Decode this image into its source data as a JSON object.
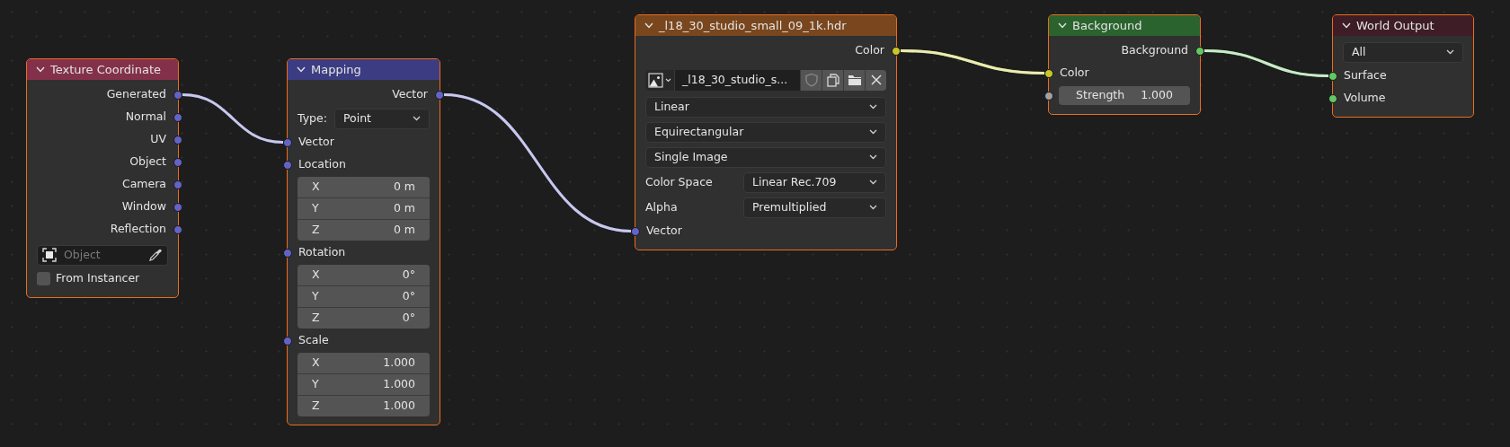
{
  "nodes": [
    {
      "title": "Texture Coordinate",
      "color": "#83314a",
      "selected": true,
      "items": [
        {
          "kind": "output",
          "label": "Generated",
          "color": "#6363c7"
        },
        {
          "kind": "output",
          "label": "Normal",
          "color": "#6363c7"
        },
        {
          "kind": "output",
          "label": "UV",
          "color": "#6363c7"
        },
        {
          "kind": "output",
          "label": "Object",
          "color": "#6363c7"
        },
        {
          "kind": "output",
          "label": "Camera",
          "color": "#6363c7"
        },
        {
          "kind": "output",
          "label": "Window",
          "color": "#6363c7"
        },
        {
          "kind": "output",
          "label": "Reflection",
          "color": "#6363c7"
        },
        {
          "kind": "object_field",
          "placeholder": "Object"
        },
        {
          "kind": "checkbox",
          "label": "From Instancer",
          "checked": false
        }
      ]
    },
    {
      "title": "Mapping",
      "color": "#3c3c83",
      "selected": true,
      "items": [
        {
          "kind": "output",
          "label": "Vector",
          "color": "#6363c7"
        },
        {
          "kind": "labeled_dropdown",
          "label": "Type:",
          "value": "Point"
        },
        {
          "kind": "input",
          "label": "Vector",
          "color": "#6363c7"
        },
        {
          "kind": "input",
          "label": "Location",
          "color": "#6363c7"
        },
        {
          "kind": "vector_fields",
          "fields": [
            {
              "axis": "X",
              "value": "0 m"
            },
            {
              "axis": "Y",
              "value": "0 m"
            },
            {
              "axis": "Z",
              "value": "0 m"
            }
          ]
        },
        {
          "kind": "input",
          "label": "Rotation",
          "color": "#6363c7"
        },
        {
          "kind": "vector_fields",
          "fields": [
            {
              "axis": "X",
              "value": "0°"
            },
            {
              "axis": "Y",
              "value": "0°"
            },
            {
              "axis": "Z",
              "value": "0°"
            }
          ]
        },
        {
          "kind": "input",
          "label": "Scale",
          "color": "#6363c7"
        },
        {
          "kind": "vector_fields",
          "fields": [
            {
              "axis": "X",
              "value": "1.000"
            },
            {
              "axis": "Y",
              "value": "1.000"
            },
            {
              "axis": "Z",
              "value": "1.000"
            }
          ]
        }
      ]
    },
    {
      "title": "_l18_30_studio_small_09_1k.hdr",
      "color": "#79461d",
      "selected": true,
      "items": [
        {
          "kind": "output",
          "label": "Color",
          "color": "#c7c729"
        },
        {
          "kind": "image_selector",
          "name": "_l18_30_studio_s..."
        },
        {
          "kind": "dropdown",
          "value": "Linear"
        },
        {
          "kind": "dropdown",
          "value": "Equirectangular"
        },
        {
          "kind": "dropdown",
          "value": "Single Image"
        },
        {
          "kind": "labeled_dropdown",
          "label": "Color Space",
          "value": "Linear Rec.709"
        },
        {
          "kind": "labeled_dropdown",
          "label": "Alpha",
          "value": "Premultiplied"
        },
        {
          "kind": "input",
          "label": "Vector",
          "color": "#6363c7"
        }
      ]
    },
    {
      "title": "Background",
      "color": "#2b632e",
      "selected": true,
      "items": [
        {
          "kind": "output",
          "label": "Background",
          "color": "#63c763"
        },
        {
          "kind": "input",
          "label": "Color",
          "color": "#c7c729"
        },
        {
          "kind": "value_input",
          "label": "Strength",
          "value": "1.000",
          "color": "#a1a1a1"
        }
      ]
    },
    {
      "title": "World Output",
      "color": "#3e1d27",
      "selected": true,
      "items": [
        {
          "kind": "dropdown",
          "value": "All"
        },
        {
          "kind": "input",
          "label": "Surface",
          "color": "#63c763"
        },
        {
          "kind": "input",
          "label": "Volume",
          "color": "#63c763"
        }
      ]
    }
  ]
}
